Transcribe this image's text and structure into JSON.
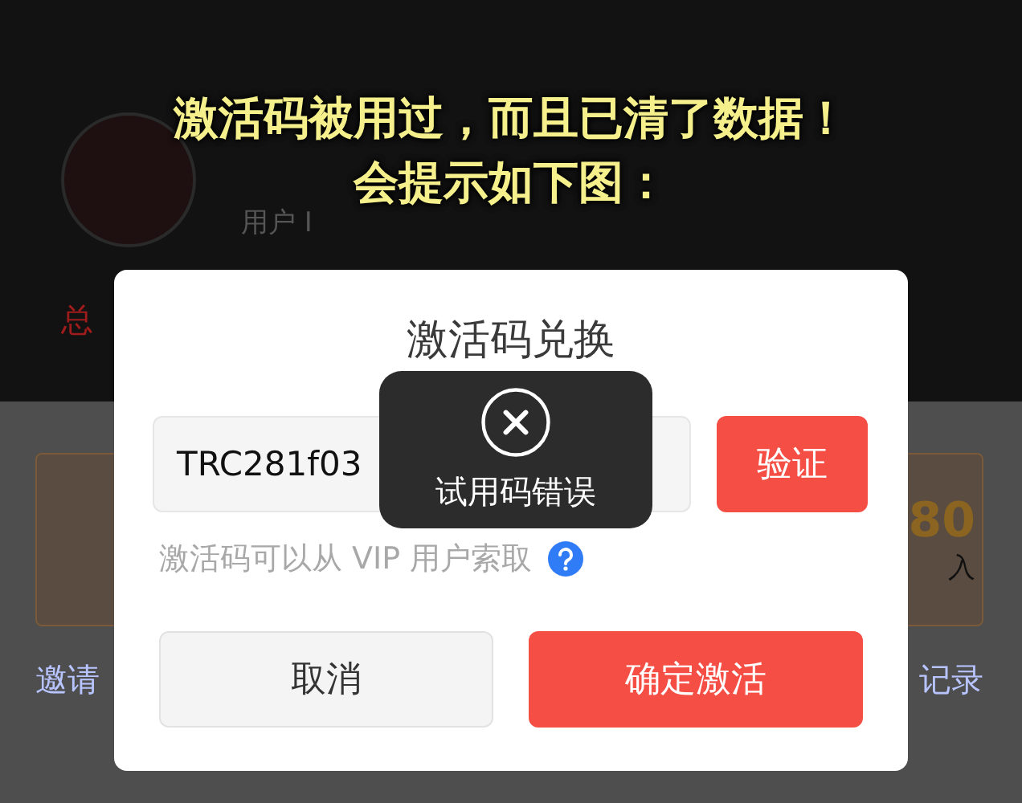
{
  "annotation": {
    "lines": [
      "激活码被用过，而且已清了数据！",
      "会提示如下图："
    ]
  },
  "background": {
    "user_label": "用户 I",
    "notice": "总",
    "card_number": "80",
    "card_caption": "入",
    "left_link": "邀请",
    "right_link": "记录"
  },
  "dialog": {
    "title": "激活码兑换",
    "code_field": {
      "value": "TRC281f03"
    },
    "verify_button": "验证",
    "hint": "激活码可以从 VIP 用户索取",
    "buttons": [
      {
        "label": "取消",
        "kind": "secondary"
      },
      {
        "label": "确定激活",
        "kind": "primary"
      }
    ]
  },
  "toast": {
    "message": "试用码错误"
  }
}
